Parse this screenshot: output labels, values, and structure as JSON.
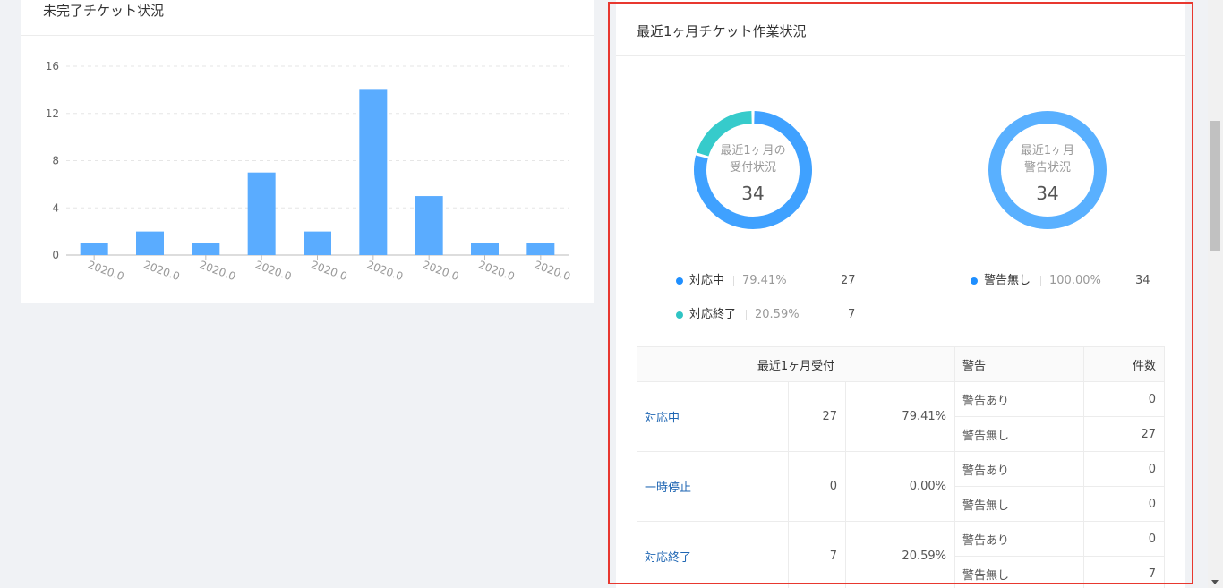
{
  "left_panel": {
    "title": "未完了チケット状況"
  },
  "chart_data": {
    "type": "bar",
    "categories": [
      "2020.0",
      "2020.0",
      "2020.0",
      "2020.0",
      "2020.0",
      "2020.0",
      "2020.0",
      "2020.0",
      "2020.0"
    ],
    "values": [
      1,
      2,
      1,
      7,
      2,
      14,
      5,
      1,
      1
    ],
    "yticks": [
      0,
      4,
      8,
      12,
      16
    ],
    "ylim": [
      0,
      16
    ],
    "grid": true,
    "bar_color": "#5aacff"
  },
  "right_panel": {
    "title": "最近1ヶ月チケット作業状況",
    "donut_reception": {
      "label_line1": "最近1ヶ月の",
      "label_line2": "受付状況",
      "total": "34",
      "segments": [
        {
          "name": "対応中",
          "value": 27,
          "color": "#3fa1ff"
        },
        {
          "name": "対応終了",
          "value": 7,
          "color": "#36cbcb"
        }
      ]
    },
    "donut_warning": {
      "label_line1": "最近1ヶ月",
      "label_line2": "警告状況",
      "total": "34",
      "segments": [
        {
          "name": "警告無し",
          "value": 34,
          "color": "#59b0ff"
        }
      ]
    },
    "legend_reception": [
      {
        "name": "対応中",
        "pct": "79.41%",
        "count": "27",
        "color": "#1f8fff"
      },
      {
        "name": "対応終了",
        "pct": "20.59%",
        "count": "7",
        "color": "#2fc4c4"
      }
    ],
    "legend_warning": [
      {
        "name": "警告無し",
        "pct": "100.00%",
        "count": "34",
        "color": "#1f8fff"
      }
    ],
    "table": {
      "headers": {
        "reception": "最近1ヶ月受付",
        "warning": "警告",
        "count": "件数"
      },
      "rows": [
        {
          "status": "対応中",
          "count": "27",
          "pct": "79.41%",
          "warn": [
            {
              "label": "警告あり",
              "count": "0"
            },
            {
              "label": "警告無し",
              "count": "27"
            }
          ]
        },
        {
          "status": "一時停止",
          "count": "0",
          "pct": "0.00%",
          "warn": [
            {
              "label": "警告あり",
              "count": "0"
            },
            {
              "label": "警告無し",
              "count": "0"
            }
          ]
        },
        {
          "status": "対応終了",
          "count": "7",
          "pct": "20.59%",
          "warn": [
            {
              "label": "警告あり",
              "count": "0"
            },
            {
              "label": "警告無し",
              "count": "7"
            }
          ]
        }
      ]
    }
  },
  "colors": {
    "highlight": "#e8382f",
    "link": "#1f66b3"
  }
}
